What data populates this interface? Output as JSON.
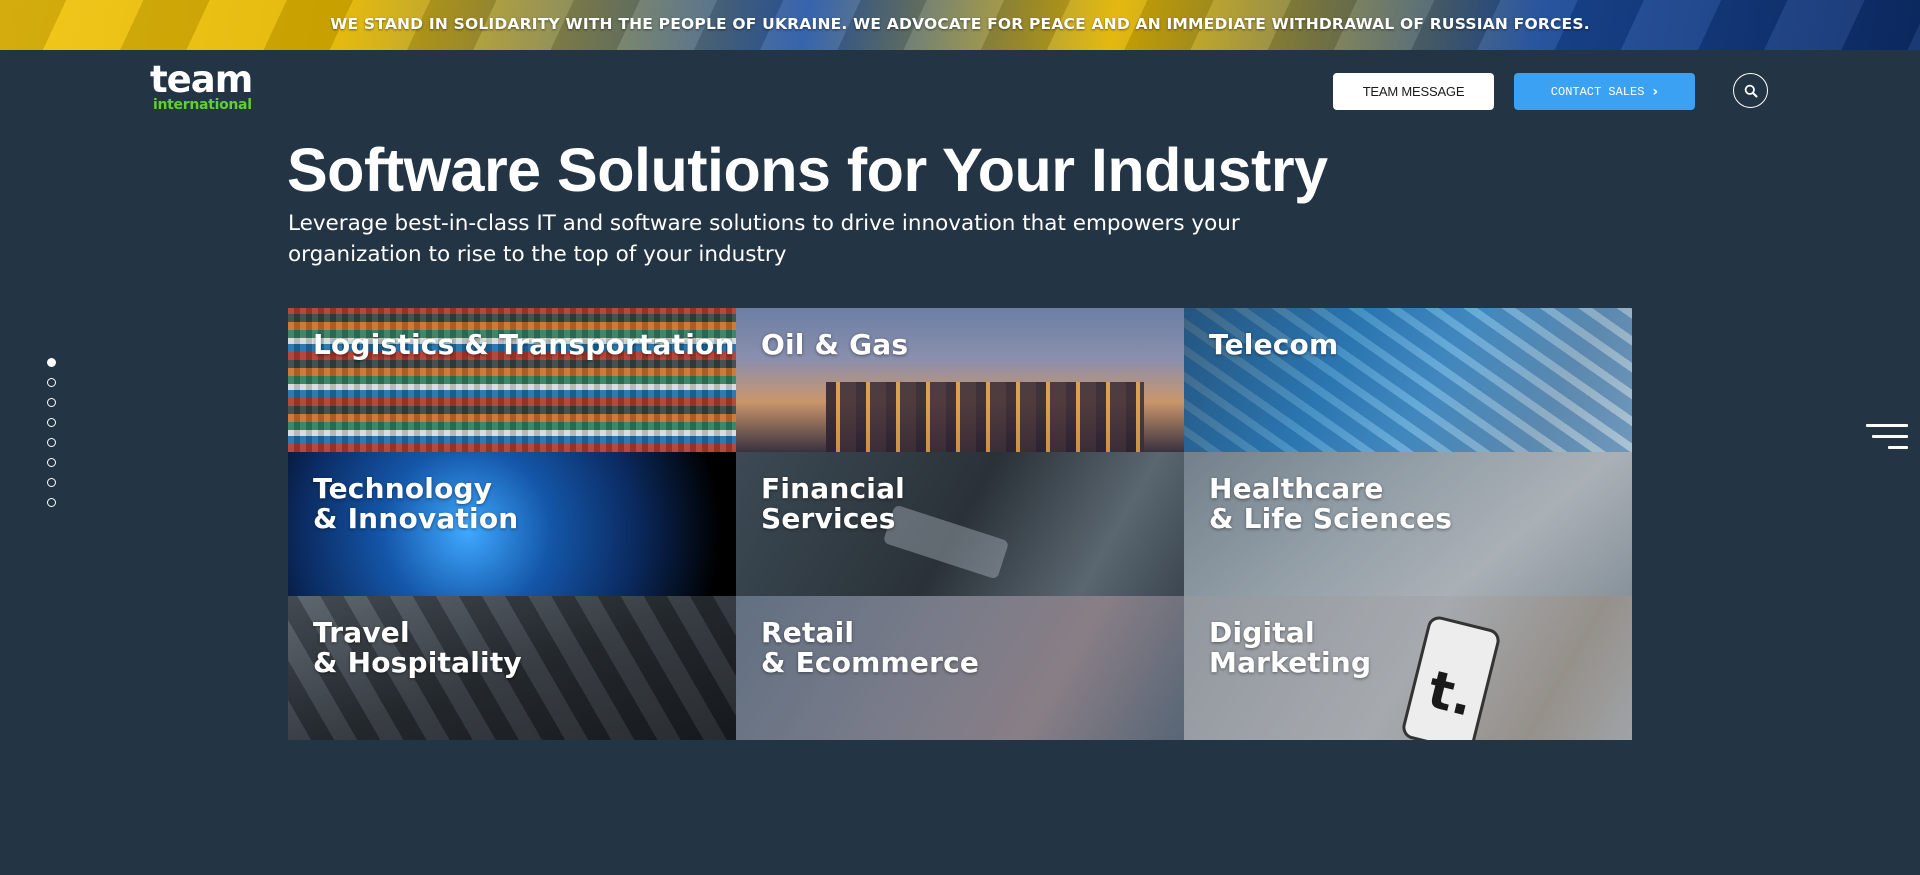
{
  "banner": {
    "text": "WE STAND IN SOLIDARITY WITH THE PEOPLE OF UKRAINE. WE ADVOCATE FOR PEACE AND AN IMMEDIATE WITHDRAWAL OF RUSSIAN FORCES."
  },
  "header": {
    "logo_main": "team",
    "logo_sub": "international",
    "team_message_label": "TEAM MESSAGE",
    "contact_sales_label": "CONTACT SALES",
    "search_icon": "search-icon"
  },
  "hero": {
    "title": "Software Solutions for Your Industry",
    "subtitle": "Leverage best-in-class IT and software solutions to drive innovation that empowers your organization to rise to the top of your industry"
  },
  "industries": [
    {
      "label": "Logistics & Transportation"
    },
    {
      "label": "Oil & Gas"
    },
    {
      "label": "Telecom"
    },
    {
      "label": "Technology\n& Innovation"
    },
    {
      "label": "Financial\nServices"
    },
    {
      "label": "Healthcare\n& Life Sciences"
    },
    {
      "label": "Travel\n& Hospitality"
    },
    {
      "label": "Retail\n& Ecommerce"
    },
    {
      "label": "Digital\nMarketing"
    }
  ],
  "digital_marketing_phone_text": "t.",
  "side_nav": {
    "dot_count": 8,
    "active_index": 0
  },
  "colors": {
    "background": "#233445",
    "accent_blue": "#3ba2f3",
    "logo_green": "#5fd02e"
  },
  "menu_icon": "hamburger-menu-icon"
}
